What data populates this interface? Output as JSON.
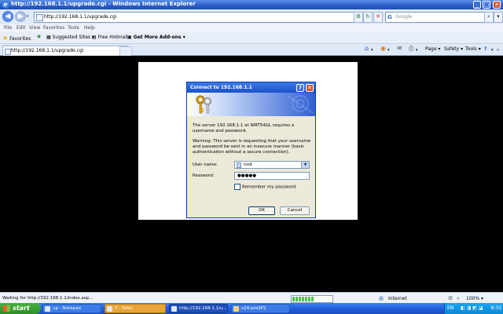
{
  "window": {
    "title": "http://192.168.1.1/upgrade.cgi - Windows Internet Explorer",
    "minimize": "_",
    "maximize": "□",
    "close": "✕"
  },
  "address_bar": {
    "url": "http://192.168.1.1/upgrade.cgi",
    "search_placeholder": "Google",
    "search_engine_glyph": "G"
  },
  "menu": [
    "File",
    "Edit",
    "View",
    "Favorites",
    "Tools",
    "Help"
  ],
  "favorites_bar": {
    "favorites_label": "Favorites",
    "items": [
      "Suggested Sites ▾",
      "Free Hotmail",
      "Get More Add-ons ▾"
    ]
  },
  "tab": {
    "label": "http://192.168.1.1/upgrade.cgi"
  },
  "command_bar": {
    "page_label": "Page ▾",
    "safety_label": "Safety ▾",
    "tools_label": "Tools ▾"
  },
  "dialog": {
    "title": "Connect to 192.168.1.1",
    "help": "?",
    "close": "✕",
    "message": "The server 192.168.1.1 at WRT54GL requires a username and password.",
    "warning": "Warning: This server is requesting that your username and password be sent in an insecure manner (basic authentication without a secure connection).",
    "username_label": "User name:",
    "username_value": "root",
    "password_label": "Password:",
    "password_value": "●●●●●",
    "remember_label": "Remember my password",
    "ok_label": "OK",
    "cancel_label": "Cancel"
  },
  "status_bar": {
    "status_text": "Waiting for http://192.168.1.1/index.asp...",
    "zone": "Internet",
    "zoom": "100% ▾",
    "progress": 0.55
  },
  "taskbar": {
    "start_label": "start",
    "tasks": [
      "up - Notepad",
      "7 - Paint",
      "http://192.168.1.1/u...",
      "v24-pre3P2"
    ],
    "language": "EN",
    "clock": "8:33"
  },
  "colors": {
    "accent": "#245edb",
    "dialog_bg": "#ece9d8"
  }
}
